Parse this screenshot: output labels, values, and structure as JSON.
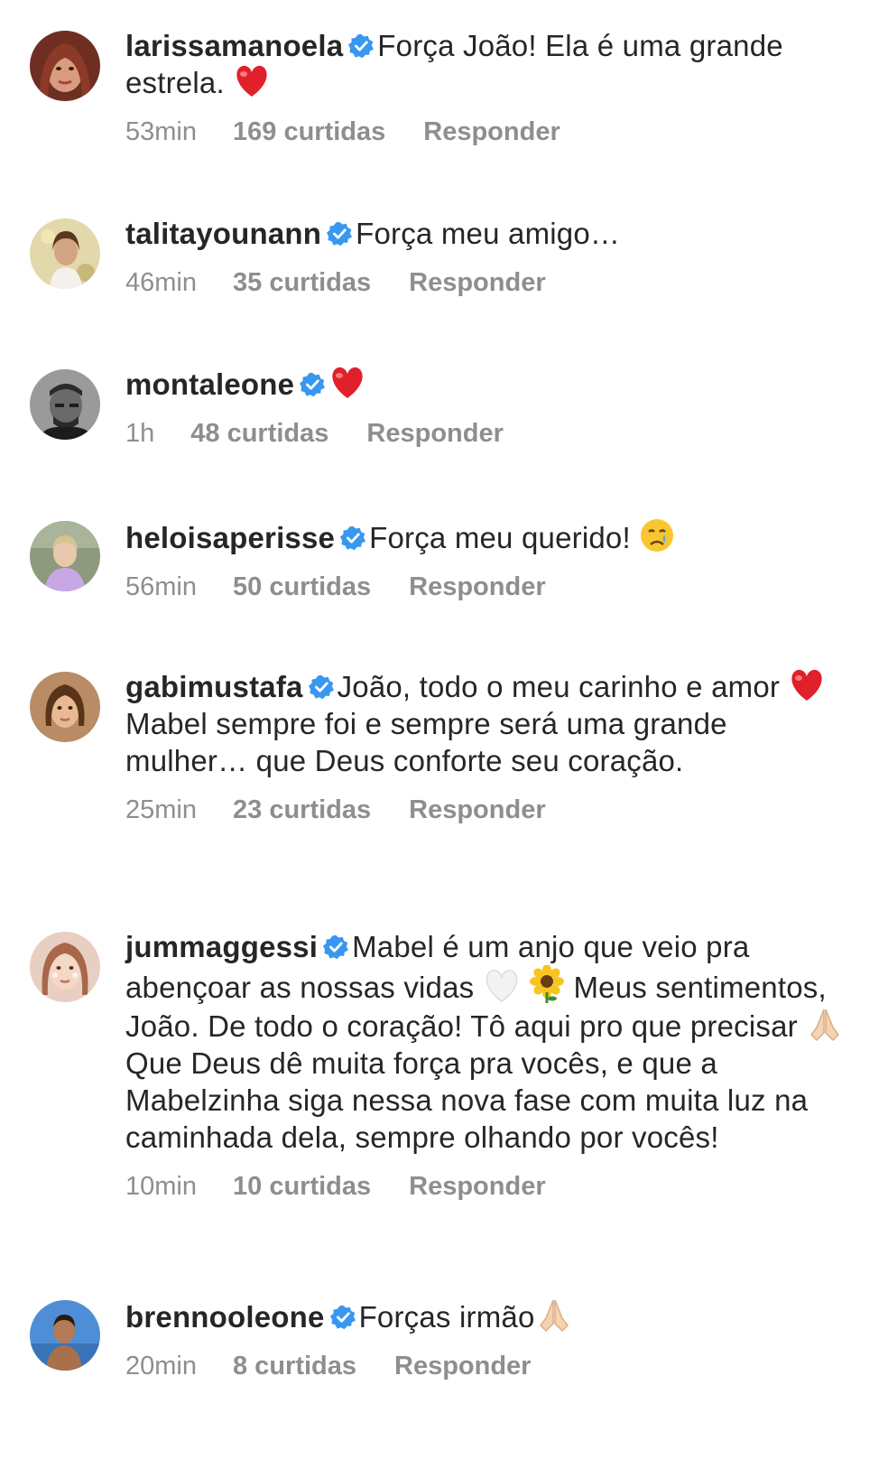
{
  "comments": [
    {
      "username": "larissamanoela",
      "text_before": "Força João! Ela é uma grande estrela. ",
      "emoji": "heart",
      "text_after": "",
      "time": "53min",
      "likes": "169 curtidas",
      "reply": "Responder",
      "avatar_color": "#7a3a2a"
    },
    {
      "username": "talitayounann",
      "text_before": "Força meu amigo…",
      "emoji": "",
      "text_after": "",
      "time": "46min",
      "likes": "35 curtidas",
      "reply": "Responder",
      "avatar_color": "#d8c79a"
    },
    {
      "username": "montaleone",
      "text_before": "",
      "emoji": "heart",
      "text_after": "",
      "time": "1h",
      "likes": "48 curtidas",
      "reply": "Responder",
      "avatar_color": "#5a5a5a"
    },
    {
      "username": "heloisaperisse",
      "text_before": "Força meu querido! ",
      "emoji": "crying-face",
      "text_after": "",
      "time": "56min",
      "likes": "50 curtidas",
      "reply": "Responder",
      "avatar_color": "#b6b7a8"
    },
    {
      "username": "gabimustafa",
      "text_before": "João, todo o meu carinho e amor ",
      "emoji": "heart",
      "text_after": " Mabel sempre foi e sempre será uma grande mulher… que Deus conforte seu coração.",
      "time": "25min",
      "likes": "23 curtidas",
      "reply": "Responder",
      "avatar_color": "#c8a07a"
    },
    {
      "username": "jummaggessi",
      "text_before": "Mabel é um anjo que veio pra abençoar as nossas vidas ",
      "emoji": "white-heart-sunflower",
      "text_mid": " Meus sentimentos, João. De todo o coração! Tô aqui pro que precisar ",
      "emoji2": "folded-hands",
      "text_after": " Que Deus dê muita força pra vocês, e que a Mabelzinha siga nessa nova fase com muita luz na caminhada dela, sempre olhando por vocês!",
      "time": "10min",
      "likes": "10 curtidas",
      "reply": "Responder",
      "avatar_color": "#d9b7a6"
    },
    {
      "username": "brennooleone",
      "text_before": "Forças irmão",
      "emoji": "folded-hands",
      "text_after": "",
      "time": "20min",
      "likes": "8 curtidas",
      "reply": "Responder",
      "avatar_color": "#4a7fc0"
    }
  ],
  "colors": {
    "verified_blue": "#3897f0",
    "meta_gray": "#8e8e8e",
    "text": "#262626"
  },
  "icons": [
    "verified-badge-icon",
    "heart-emoji",
    "crying-face-emoji",
    "white-heart-emoji",
    "sunflower-emoji",
    "folded-hands-emoji"
  ]
}
